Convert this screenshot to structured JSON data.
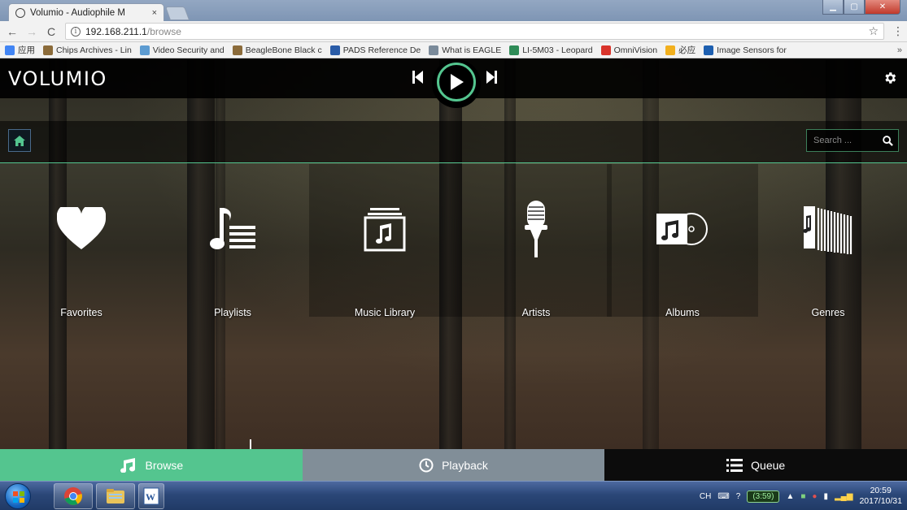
{
  "browser": {
    "tab_title": "Volumio - Audiophile M",
    "tab_close": "×",
    "url_host": "192.168.211.1",
    "url_path": "/browse",
    "star": "☆",
    "menu": "⋮",
    "bookmarks": [
      {
        "label": "应用",
        "icon_color": "#4285f4",
        "icon_name": "apps-grid-icon"
      },
      {
        "label": "Chips Archives - Lin",
        "icon_color": "#8b6b3a",
        "icon_name": "chips-archive-icon"
      },
      {
        "label": "Video Security and",
        "icon_color": "#5c9bd1",
        "icon_name": "video-security-icon"
      },
      {
        "label": "BeagleBone Black c",
        "icon_color": "#8b6b3a",
        "icon_name": "beaglebone-icon"
      },
      {
        "label": "PADS Reference De",
        "icon_color": "#2a5ca8",
        "icon_name": "pads-reference-icon"
      },
      {
        "label": "What is EAGLE",
        "icon_color": "#7a8a9a",
        "icon_name": "eagle-icon"
      },
      {
        "label": "LI-5M03 - Leopard",
        "icon_color": "#2e8b57",
        "icon_name": "leopard-icon"
      },
      {
        "label": "OmniVision",
        "icon_color": "#d9342b",
        "icon_name": "omnivision-icon"
      },
      {
        "label": "必应",
        "icon_color": "#f2b01e",
        "icon_name": "bing-icon"
      },
      {
        "label": "Image Sensors for",
        "icon_color": "#1d5fb0",
        "icon_name": "image-sensors-icon"
      }
    ],
    "bookmarks_more": "»"
  },
  "app": {
    "logo": "VOLUMIO",
    "search_placeholder": "Search ...",
    "accent_color": "#54c58f",
    "tiles": [
      {
        "label": "Favorites",
        "icon": "heart-icon"
      },
      {
        "label": "Playlists",
        "icon": "playlist-icon"
      },
      {
        "label": "Music Library",
        "icon": "music-library-icon"
      },
      {
        "label": "Artists",
        "icon": "microphone-icon"
      },
      {
        "label": "Albums",
        "icon": "album-icon"
      },
      {
        "label": "Genres",
        "icon": "genres-icon"
      },
      {
        "label": "",
        "icon": "last100-icon"
      },
      {
        "label": "",
        "icon": "web-radio-icon"
      }
    ],
    "footer": {
      "browse": "Browse",
      "playback": "Playback",
      "queue": "Queue"
    }
  },
  "taskbar": {
    "ime": "CH",
    "battery": "(3:59)",
    "time": "20:59",
    "date": "2017/10/31"
  }
}
